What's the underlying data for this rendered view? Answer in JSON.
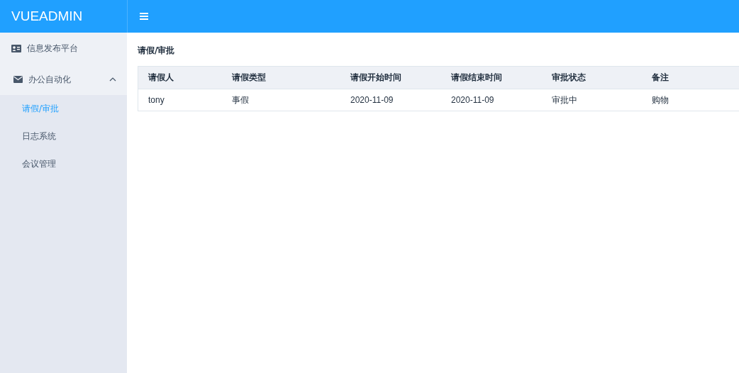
{
  "brand": "VUEADMIN",
  "sidebar": {
    "items": [
      {
        "kind": "item",
        "label": "信息发布平台",
        "selected": false
      },
      {
        "kind": "submenu",
        "label": "办公自动化",
        "expanded": true,
        "children": [
          {
            "label": "请假/审批",
            "selected": true
          },
          {
            "label": "日志系统",
            "selected": false
          },
          {
            "label": "会议管理",
            "selected": false
          }
        ]
      }
    ]
  },
  "page_title": "请假/审批",
  "table": {
    "columns": [
      "请假人",
      "请假类型",
      "请假开始时间",
      "请假结束时间",
      "审批状态",
      "备注"
    ],
    "rows": [
      [
        "tony",
        "事假",
        "2020-11-09",
        "2020-11-09",
        "审批中",
        "购物"
      ]
    ]
  }
}
